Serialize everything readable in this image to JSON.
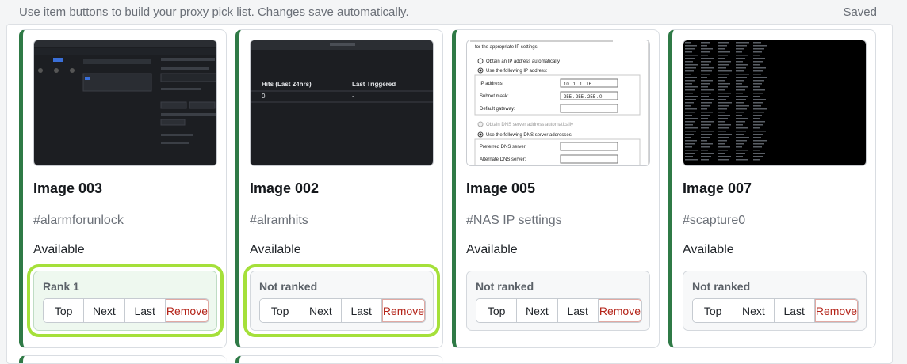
{
  "header": {
    "hint": "Use item buttons to build your proxy pick list. Changes save automatically.",
    "save_status": "Saved"
  },
  "cards": [
    {
      "title": "Image 003",
      "tag": "#alarmforunlock",
      "status": "Available",
      "rank_label": "Rank 1",
      "ranked": true,
      "buttons": {
        "top": "Top",
        "next": "Next",
        "last": "Last",
        "remove": "Remove"
      }
    },
    {
      "title": "Image 002",
      "tag": "#alramhits",
      "status": "Available",
      "rank_label": "Not ranked",
      "ranked": false,
      "thumb": {
        "col1": "Hits (Last 24hrs)",
        "col2": "Last Triggered",
        "val1": "0",
        "val2": "-"
      },
      "buttons": {
        "top": "Top",
        "next": "Next",
        "last": "Last",
        "remove": "Remove"
      }
    },
    {
      "title": "Image 005",
      "tag": "#NAS IP settings",
      "status": "Available",
      "rank_label": "Not ranked",
      "ranked": false,
      "thumb": {
        "intro": "for the appropriate IP settings.",
        "opt_auto": "Obtain an IP address automatically",
        "opt_manual": "Use the following IP address:",
        "ip_label": "IP address:",
        "ip_value": "10 . 1 . 1 . 16",
        "mask_label": "Subnet mask:",
        "mask_value": "255 . 255 . 255 . 0",
        "gw_label": "Default gateway:",
        "dns_auto": "Obtain DNS server address automatically",
        "dns_manual": "Use the following DNS server addresses:",
        "dns_pref": "Preferred DNS server:",
        "dns_alt": "Alternate DNS server:"
      },
      "buttons": {
        "top": "Top",
        "next": "Next",
        "last": "Last",
        "remove": "Remove"
      }
    },
    {
      "title": "Image 007",
      "tag": "#scapture0",
      "status": "Available",
      "rank_label": "Not ranked",
      "ranked": false,
      "buttons": {
        "top": "Top",
        "next": "Next",
        "last": "Last",
        "remove": "Remove"
      }
    }
  ],
  "colors": {
    "accent": "#2f7a46",
    "highlight": "#a5e03a",
    "remove": "#b42318"
  }
}
